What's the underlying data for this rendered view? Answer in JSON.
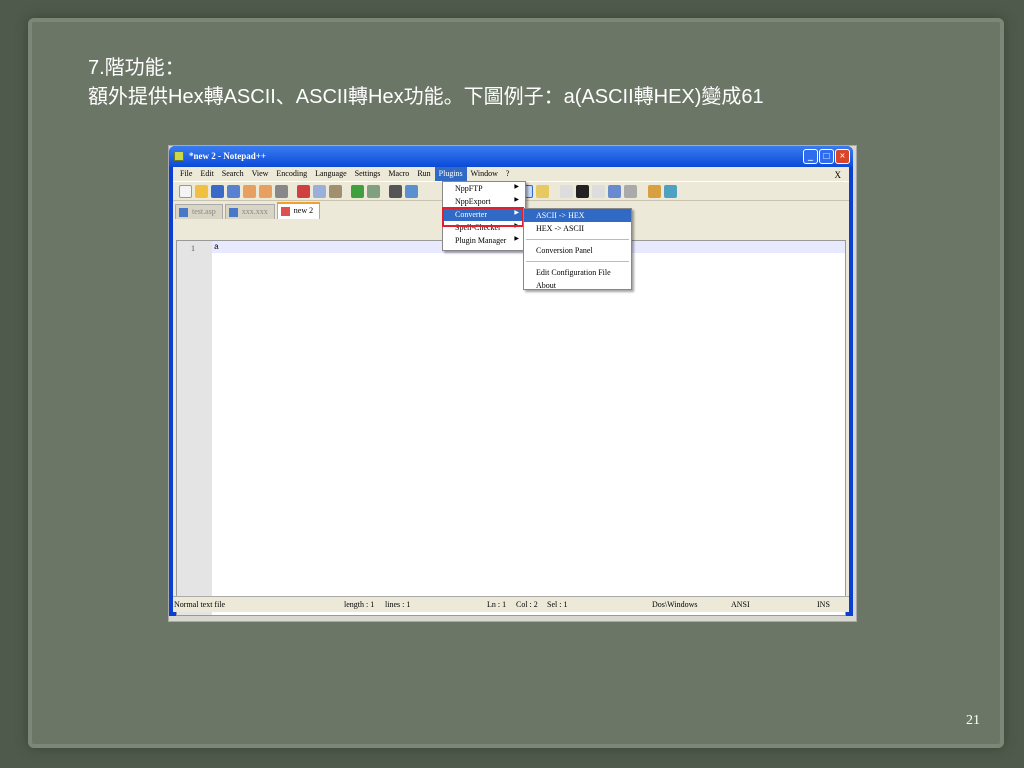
{
  "slide": {
    "title_line1": "7.階功能：",
    "title_line2": "額外提供Hex轉ASCII、ASCII轉Hex功能。下圖例子：a(ASCII轉HEX)變成61",
    "page_number": "21"
  },
  "window": {
    "title": "*new  2 - Notepad++",
    "close_doc": "X",
    "menu": [
      "File",
      "Edit",
      "Search",
      "View",
      "Encoding",
      "Language",
      "Settings",
      "Macro",
      "Run",
      "Plugins",
      "Window",
      "?"
    ],
    "tabs": [
      "test.asp",
      "xxx.xxx",
      "new  2"
    ],
    "line_number": "1",
    "line_text": "a",
    "status": {
      "type": "Normal text file",
      "length": "length : 1",
      "lines": "lines : 1",
      "ln": "Ln : 1",
      "col": "Col : 2",
      "sel": "Sel : 1",
      "eol": "Dos\\Windows",
      "encoding": "ANSI",
      "mode": "INS"
    }
  },
  "plugins_menu": [
    "NppFTP",
    "NppExport",
    "Converter",
    "Spell-Checker",
    "Plugin Manager"
  ],
  "converter_submenu": {
    "items_top": [
      "ASCII -> HEX",
      "HEX -> ASCII"
    ],
    "panel": "Conversion Panel",
    "edit": "Edit Configuration File",
    "about": "About"
  },
  "colors": {
    "highlight": "#316ac5",
    "redbox": "#e0202a"
  }
}
